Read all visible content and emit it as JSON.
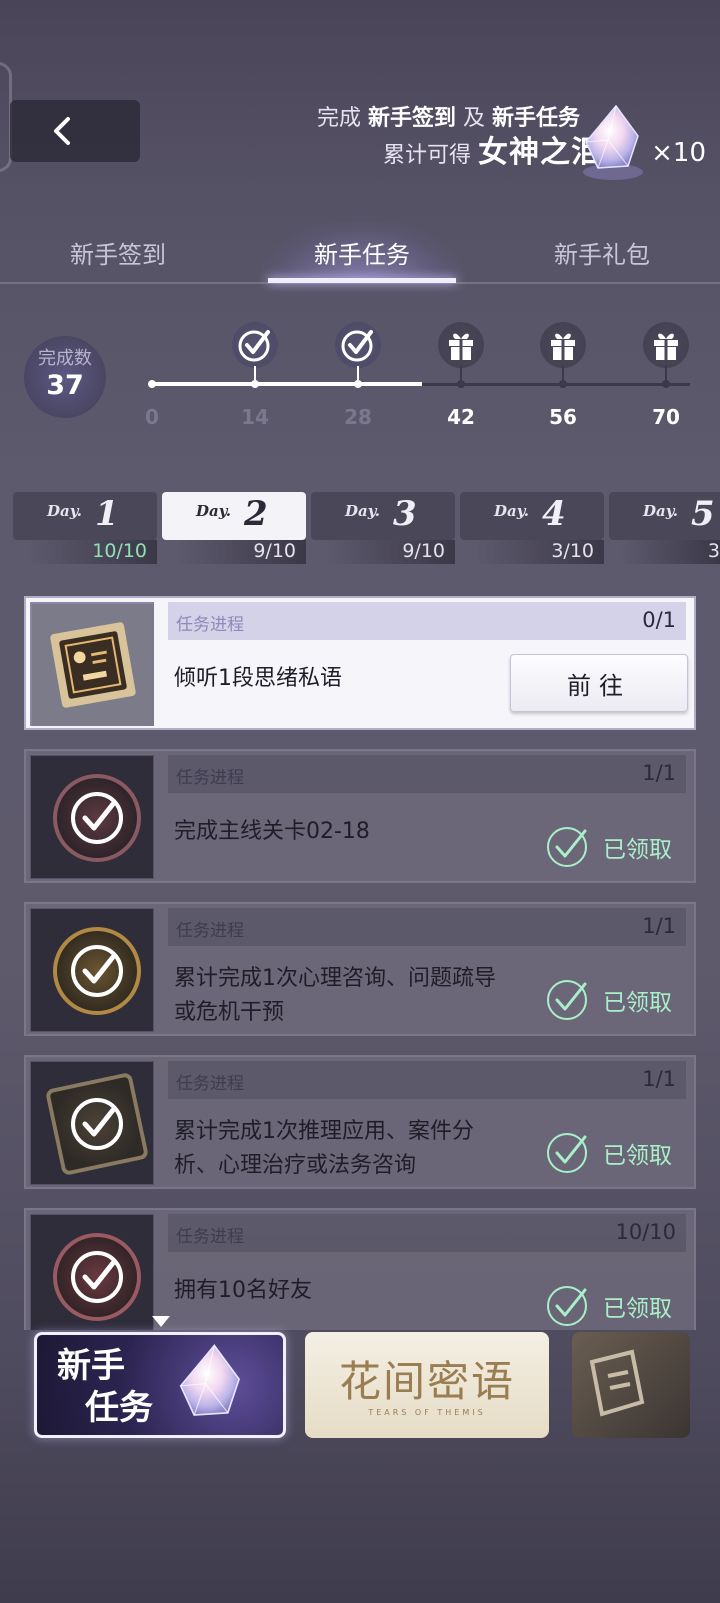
{
  "header": {
    "promo_complete": "完成",
    "promo_signin": "新手签到",
    "promo_and": "及",
    "promo_tasks": "新手任务",
    "promo_total": "累计可得",
    "promo_reward": "女神之泪",
    "promo_qty": "×10"
  },
  "tabs": [
    {
      "label": "新手签到",
      "active": false
    },
    {
      "label": "新手任务",
      "active": true
    },
    {
      "label": "新手礼包",
      "active": false
    }
  ],
  "progress": {
    "count_label": "完成数",
    "count_value": "37",
    "milestones": [
      {
        "label": "0",
        "type": "start",
        "reached": true
      },
      {
        "label": "14",
        "type": "check",
        "reached": true
      },
      {
        "label": "28",
        "type": "check",
        "reached": true
      },
      {
        "label": "42",
        "type": "gift",
        "reached": false
      },
      {
        "label": "56",
        "type": "gift",
        "reached": false
      },
      {
        "label": "70",
        "type": "gift",
        "reached": false
      }
    ]
  },
  "days": [
    {
      "label": "Day.",
      "num": "1",
      "progress": "10/10",
      "active": false,
      "complete": true
    },
    {
      "label": "Day.",
      "num": "2",
      "progress": "9/10",
      "active": true,
      "complete": false
    },
    {
      "label": "Day.",
      "num": "3",
      "progress": "9/10",
      "active": false,
      "complete": false
    },
    {
      "label": "Day.",
      "num": "4",
      "progress": "3/10",
      "active": false,
      "complete": false
    },
    {
      "label": "Day.",
      "num": "5",
      "progress": "3",
      "active": false,
      "complete": false
    }
  ],
  "tasks": [
    {
      "progress_label": "任务进程",
      "progress": "0/1",
      "desc": "倾听1段思绪私语",
      "status": "go",
      "action": "前往"
    },
    {
      "progress_label": "任务进程",
      "progress": "1/1",
      "desc": "完成主线关卡02-18",
      "status": "claimed",
      "action": "已领取"
    },
    {
      "progress_label": "任务进程",
      "progress": "1/1",
      "desc": "累计完成1次心理咨询、问题疏导或危机干预",
      "status": "claimed",
      "action": "已领取"
    },
    {
      "progress_label": "任务进程",
      "progress": "1/1",
      "desc": "累计完成1次推理应用、案件分析、心理治疗或法务咨询",
      "status": "claimed",
      "action": "已领取"
    },
    {
      "progress_label": "任务进程",
      "progress": "10/10",
      "desc": "拥有10名好友",
      "status": "claimed",
      "action": "已领取"
    }
  ],
  "bottom_nav": {
    "card1_line1": "新手",
    "card1_line2": "任务",
    "card2_title": "花间密语",
    "card2_sub": "TEARS OF THEMIS"
  },
  "colors": {
    "claimed_green": "#a9efc9",
    "complete_green": "#8fe0b4"
  }
}
